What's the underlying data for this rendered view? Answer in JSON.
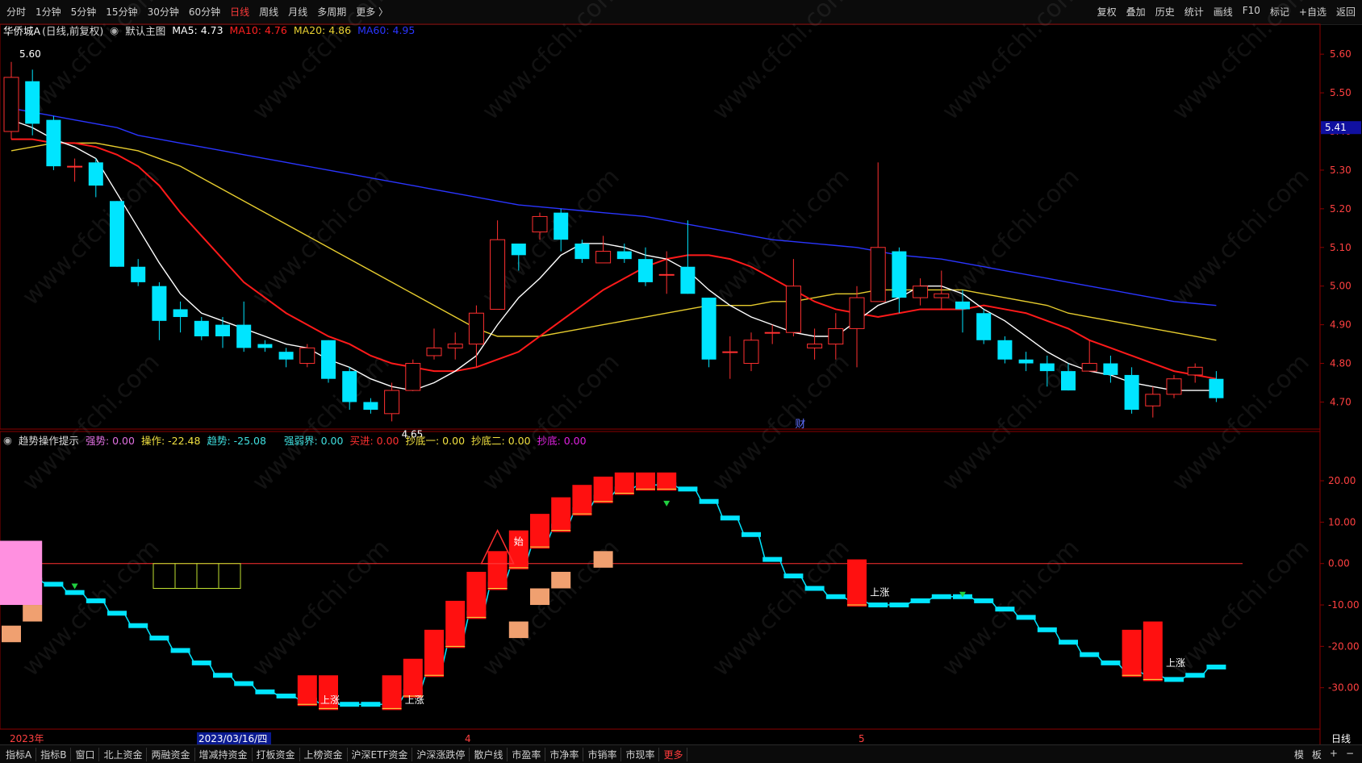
{
  "toolbar": {
    "periods": [
      "分时",
      "1分钟",
      "5分钟",
      "15分钟",
      "30分钟",
      "60分钟",
      "日线",
      "周线",
      "月线",
      "多周期",
      "更多 〉"
    ],
    "active_period": "日线",
    "right_buttons": [
      "复权",
      "叠加",
      "历史",
      "统计",
      "画线",
      "F10",
      "标记",
      "+自选",
      "返回"
    ]
  },
  "header": {
    "stock_name": "华侨城A",
    "chart_mode": "(日线,前复权)",
    "main_chart_label": "默认主图",
    "ma5": {
      "label": "MA5: 4.73",
      "color": "#ffffff"
    },
    "ma10": {
      "label": "MA10: 4.76",
      "color": "#ff2020"
    },
    "ma20": {
      "label": "MA20: 4.86",
      "color": "#e8d030"
    },
    "ma60": {
      "label": "MA60: 4.95",
      "color": "#2a35ff"
    }
  },
  "indicator": {
    "name": "趋势操作提示",
    "items": [
      {
        "label": "强势: 0.00",
        "color": "#e070e0"
      },
      {
        "label": "操作: -22.48",
        "color": "#f0e040"
      },
      {
        "label": "趋势: -25.08",
        "color": "#40e0e0"
      },
      {
        "label": "强弱界: 0.00",
        "color": "#40e0e0"
      },
      {
        "label": "买进: 0.00",
        "color": "#ff3030"
      },
      {
        "label": "抄底一: 0.00",
        "color": "#f0e040"
      },
      {
        "label": "抄底二: 0.00",
        "color": "#f0e040"
      },
      {
        "label": "抄底: 0.00",
        "color": "#e020e0"
      }
    ]
  },
  "annotations": {
    "high_label": "5.60",
    "low_label": "4.65",
    "price_tag": "5.41",
    "cai_marker": "财",
    "shi_marker": "始",
    "up_label": "上涨",
    "kai_marker": "买进"
  },
  "colors": {
    "up": "#ff3030",
    "down": "#00e5ff",
    "ma5": "#ffffff",
    "ma10": "#ff1a1a",
    "ma20": "#e6cc2e",
    "ma60": "#2a35ff",
    "grid": "#8b0000"
  },
  "bottom_tabs": [
    "指标A",
    "指标B",
    "窗口",
    "北上资金",
    "两融资金",
    "增减持资金",
    "打板资金",
    "上榜资金",
    "沪深ETF资金",
    "沪深涨跌停",
    "散户线",
    "市盈率",
    "市净率",
    "市销率",
    "市现率",
    "更多"
  ],
  "bottom_right": [
    "模",
    "板",
    "+",
    "−"
  ],
  "chart_data": [
    {
      "type": "candlestick",
      "title": "华侨城A (日线,前复权)",
      "x_ticks": [
        "2023年",
        "2023/03/16/四",
        "4",
        "5"
      ],
      "period_label": "日线",
      "y_ticks": [
        "5.60",
        "5.50",
        "5.40",
        "5.30",
        "5.20",
        "5.10",
        "5.00",
        "4.90",
        "4.80",
        "4.70"
      ],
      "ylim": [
        4.63,
        5.64
      ],
      "candles": [
        [
          5.4,
          5.54,
          5.58,
          5.38
        ],
        [
          5.53,
          5.42,
          5.56,
          5.39
        ],
        [
          5.43,
          5.31,
          5.44,
          5.3
        ],
        [
          5.31,
          5.31,
          5.33,
          5.27
        ],
        [
          5.32,
          5.26,
          5.33,
          5.23
        ],
        [
          5.22,
          5.05,
          5.22,
          5.05
        ],
        [
          5.05,
          5.01,
          5.07,
          5.0
        ],
        [
          5.0,
          4.91,
          5.01,
          4.86
        ],
        [
          4.94,
          4.92,
          4.96,
          4.88
        ],
        [
          4.91,
          4.87,
          4.92,
          4.86
        ],
        [
          4.9,
          4.87,
          4.92,
          4.84
        ],
        [
          4.9,
          4.84,
          4.96,
          4.83
        ],
        [
          4.85,
          4.84,
          4.86,
          4.83
        ],
        [
          4.83,
          4.81,
          4.84,
          4.79
        ],
        [
          4.8,
          4.84,
          4.85,
          4.79
        ],
        [
          4.86,
          4.76,
          4.86,
          4.75
        ],
        [
          4.78,
          4.7,
          4.79,
          4.68
        ],
        [
          4.7,
          4.68,
          4.71,
          4.67
        ],
        [
          4.67,
          4.73,
          4.75,
          4.65
        ],
        [
          4.73,
          4.8,
          4.81,
          4.73
        ],
        [
          4.82,
          4.84,
          4.89,
          4.81
        ],
        [
          4.84,
          4.85,
          4.88,
          4.81
        ],
        [
          4.85,
          4.93,
          4.95,
          4.79
        ],
        [
          4.94,
          5.12,
          5.17,
          4.94
        ],
        [
          5.11,
          5.08,
          5.11,
          5.04
        ],
        [
          5.14,
          5.18,
          5.19,
          5.12
        ],
        [
          5.19,
          5.12,
          5.2,
          5.09
        ],
        [
          5.11,
          5.07,
          5.12,
          5.06
        ],
        [
          5.06,
          5.09,
          5.13,
          5.07
        ],
        [
          5.09,
          5.07,
          5.11,
          5.06
        ],
        [
          5.07,
          5.01,
          5.1,
          5.0
        ],
        [
          5.03,
          5.03,
          5.09,
          4.98
        ],
        [
          5.05,
          4.98,
          5.17,
          4.98
        ],
        [
          4.97,
          4.81,
          4.97,
          4.79
        ],
        [
          4.83,
          4.83,
          4.87,
          4.76
        ],
        [
          4.8,
          4.86,
          4.88,
          4.78
        ],
        [
          4.88,
          4.88,
          4.9,
          4.85
        ],
        [
          4.88,
          5.0,
          5.07,
          4.87
        ],
        [
          4.84,
          4.85,
          4.89,
          4.81
        ],
        [
          4.85,
          4.89,
          4.93,
          4.81
        ],
        [
          4.89,
          4.97,
          5.0,
          4.79
        ],
        [
          4.96,
          5.1,
          5.32,
          4.96
        ],
        [
          5.09,
          4.97,
          5.1,
          4.93
        ],
        [
          4.97,
          5.0,
          5.02,
          4.95
        ],
        [
          4.97,
          4.98,
          5.04,
          4.94
        ],
        [
          4.96,
          4.94,
          4.99,
          4.88
        ],
        [
          4.93,
          4.86,
          4.94,
          4.85
        ],
        [
          4.86,
          4.81,
          4.87,
          4.8
        ],
        [
          4.81,
          4.8,
          4.83,
          4.78
        ],
        [
          4.8,
          4.78,
          4.82,
          4.74
        ],
        [
          4.78,
          4.73,
          4.8,
          4.73
        ],
        [
          4.78,
          4.8,
          4.86,
          4.78
        ],
        [
          4.8,
          4.77,
          4.82,
          4.75
        ],
        [
          4.77,
          4.68,
          4.79,
          4.67
        ],
        [
          4.69,
          4.72,
          4.74,
          4.66
        ],
        [
          4.72,
          4.76,
          4.77,
          4.71
        ],
        [
          4.77,
          4.79,
          4.8,
          4.75
        ],
        [
          4.76,
          4.71,
          4.78,
          4.7
        ]
      ],
      "series": [
        {
          "name": "MA5",
          "values": [
            5.43,
            5.41,
            5.38,
            5.36,
            5.33,
            5.24,
            5.15,
            5.06,
            4.98,
            4.93,
            4.91,
            4.89,
            4.87,
            4.85,
            4.84,
            4.81,
            4.79,
            4.76,
            4.74,
            4.73,
            4.75,
            4.78,
            4.82,
            4.9,
            4.97,
            5.02,
            5.08,
            5.11,
            5.11,
            5.1,
            5.08,
            5.07,
            5.04,
            4.99,
            4.95,
            4.92,
            4.9,
            4.88,
            4.87,
            4.87,
            4.91,
            4.95,
            4.97,
            5.0,
            5.0,
            4.98,
            4.94,
            4.91,
            4.87,
            4.83,
            4.8,
            4.78,
            4.77,
            4.75,
            4.74,
            4.73,
            4.73,
            4.73
          ]
        },
        {
          "name": "MA10",
          "values": [
            5.38,
            5.38,
            5.37,
            5.37,
            5.36,
            5.34,
            5.31,
            5.26,
            5.19,
            5.13,
            5.07,
            5.01,
            4.97,
            4.93,
            4.9,
            4.87,
            4.85,
            4.82,
            4.8,
            4.79,
            4.78,
            4.78,
            4.79,
            4.81,
            4.83,
            4.87,
            4.91,
            4.95,
            4.99,
            5.02,
            5.05,
            5.07,
            5.08,
            5.08,
            5.07,
            5.05,
            5.02,
            4.99,
            4.96,
            4.94,
            4.93,
            4.92,
            4.93,
            4.94,
            4.94,
            4.94,
            4.95,
            4.94,
            4.93,
            4.91,
            4.89,
            4.86,
            4.84,
            4.82,
            4.8,
            4.78,
            4.77,
            4.76
          ]
        },
        {
          "name": "MA20",
          "values": [
            5.35,
            5.36,
            5.37,
            5.37,
            5.37,
            5.36,
            5.35,
            5.33,
            5.31,
            5.28,
            5.25,
            5.22,
            5.19,
            5.16,
            5.13,
            5.1,
            5.07,
            5.04,
            5.01,
            4.98,
            4.95,
            4.92,
            4.89,
            4.87,
            4.87,
            4.87,
            4.88,
            4.89,
            4.9,
            4.91,
            4.92,
            4.93,
            4.94,
            4.95,
            4.95,
            4.95,
            4.96,
            4.96,
            4.97,
            4.98,
            4.98,
            4.99,
            4.99,
            4.99,
            4.99,
            4.99,
            4.98,
            4.97,
            4.96,
            4.95,
            4.93,
            4.92,
            4.91,
            4.9,
            4.89,
            4.88,
            4.87,
            4.86
          ]
        },
        {
          "name": "MA60",
          "values": [
            5.46,
            5.45,
            5.44,
            5.43,
            5.42,
            5.41,
            5.39,
            5.38,
            5.37,
            5.36,
            5.35,
            5.34,
            5.33,
            5.32,
            5.31,
            5.3,
            5.29,
            5.28,
            5.27,
            5.26,
            5.25,
            5.24,
            5.23,
            5.22,
            5.21,
            5.205,
            5.2,
            5.195,
            5.19,
            5.185,
            5.18,
            5.17,
            5.16,
            5.15,
            5.14,
            5.13,
            5.12,
            5.115,
            5.11,
            5.105,
            5.1,
            5.09,
            5.08,
            5.075,
            5.07,
            5.06,
            5.05,
            5.04,
            5.03,
            5.02,
            5.01,
            5.0,
            4.99,
            4.98,
            4.97,
            4.96,
            4.955,
            4.95
          ]
        }
      ]
    },
    {
      "type": "bar",
      "title": "趋势操作提示",
      "y_ticks": [
        "20.00",
        "10.00",
        "0.00",
        "-10.00",
        "-20.00",
        "-30.00"
      ],
      "ylim": [
        -40,
        28
      ],
      "series": [
        {
          "name": "趋势",
          "values": [
            -3,
            -4,
            -5,
            -7,
            -9,
            -12,
            -15,
            -18,
            -21,
            -24,
            -27,
            -29,
            -31,
            -32,
            -33,
            -34,
            -34,
            -34,
            -34,
            -31,
            -26,
            -19,
            -12,
            -5,
            0,
            5,
            9,
            13,
            16,
            18,
            19,
            19,
            18,
            15,
            11,
            7,
            1,
            -3,
            -6,
            -8,
            -9,
            -10,
            -10,
            -9,
            -8,
            -8,
            -9,
            -11,
            -13,
            -16,
            -19,
            -22,
            -24,
            -26,
            -27,
            -28,
            -27,
            -25
          ]
        }
      ]
    }
  ]
}
